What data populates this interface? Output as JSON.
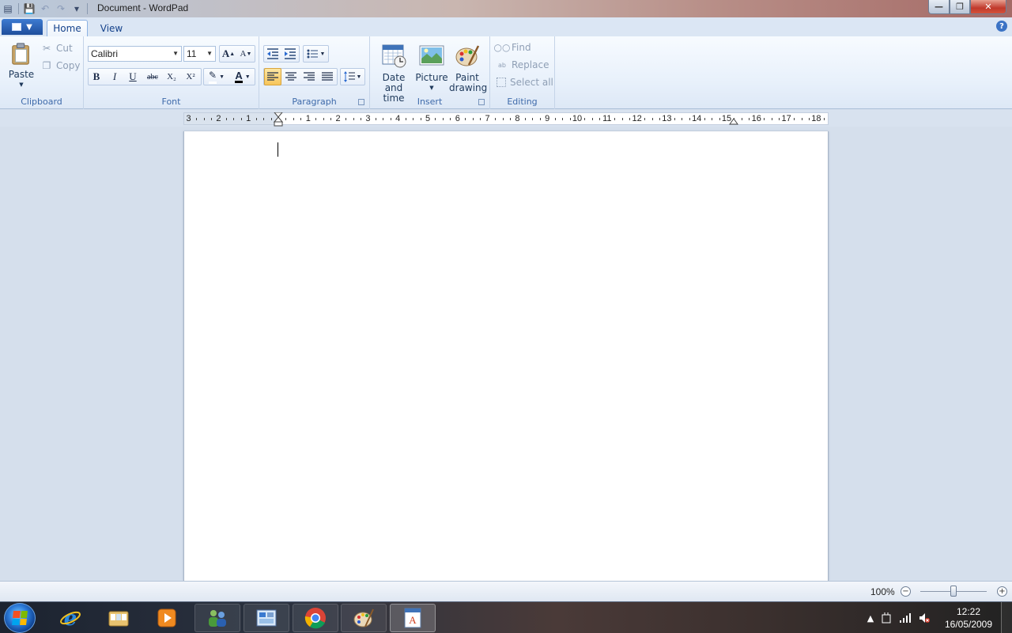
{
  "window": {
    "title": "Document - WordPad"
  },
  "tabs": [
    {
      "label": "Home"
    },
    {
      "label": "View"
    }
  ],
  "ribbon": {
    "clipboard": {
      "group_label": "Clipboard",
      "paste": "Paste",
      "cut": "Cut",
      "copy": "Copy"
    },
    "font": {
      "group_label": "Font",
      "family": "Calibri",
      "size": "11",
      "grow": "A",
      "shrink": "A",
      "bold": "B",
      "italic": "I",
      "underline": "U",
      "strikethrough": "abc",
      "subscript": "X₂",
      "superscript": "X²",
      "text_color": "A"
    },
    "paragraph": {
      "group_label": "Paragraph"
    },
    "insert": {
      "group_label": "Insert",
      "date_time": "Date and time",
      "picture": "Picture",
      "paint": "Paint drawing"
    },
    "editing": {
      "group_label": "Editing",
      "find": "Find",
      "replace": "Replace",
      "select_all": "Select all"
    }
  },
  "ruler": {
    "left_labels": [
      "3",
      "2",
      "1"
    ],
    "right_labels": [
      "1",
      "2",
      "3",
      "4",
      "5",
      "6",
      "7",
      "8",
      "9",
      "10",
      "11",
      "12",
      "13",
      "14",
      "15",
      "16",
      "17",
      "18"
    ]
  },
  "statusbar": {
    "zoom": "100%",
    "zoom_level": 0.5
  },
  "taskbar": {
    "time": "12:22",
    "date": "16/05/2009"
  },
  "colors": {
    "accent": "#15428b",
    "ribbon_bg": "#e9f1fb",
    "workspace": "#d5dfec",
    "close": "#c0392b"
  }
}
